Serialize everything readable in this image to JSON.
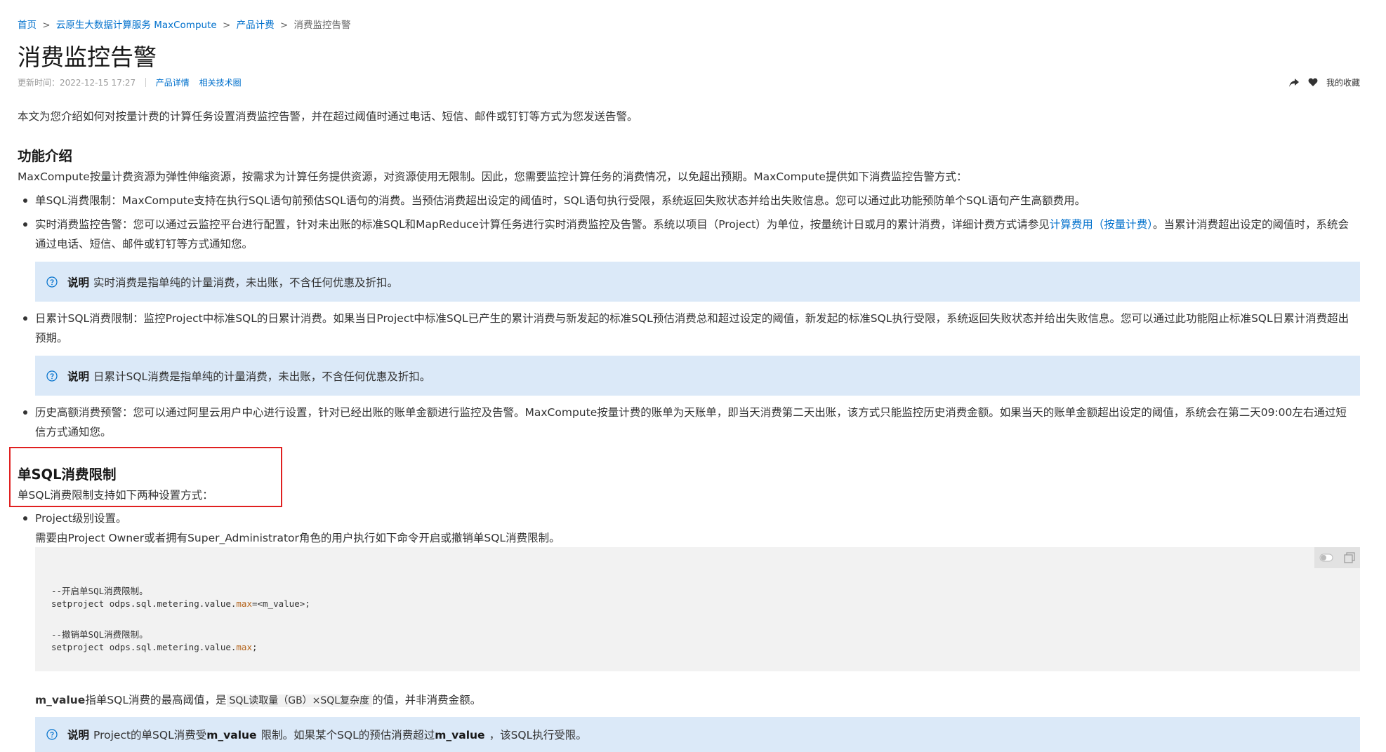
{
  "breadcrumb": {
    "items": [
      "首页",
      "云原生大数据计算服务 MaxCompute",
      "产品计费"
    ],
    "current": "消费监控告警",
    "separator": ">"
  },
  "page": {
    "title": "消费监控告警",
    "updated_label": "更新时间：2022-12-15 17:27",
    "meta_links": [
      "产品详情",
      "相关技术圈"
    ],
    "favorite_label": "我的收藏",
    "intro": "本文为您介绍如何对按量计费的计算任务设置消费监控告警，并在超过阈值时通过电话、短信、邮件或钉钉等方式为您发送告警。"
  },
  "section1": {
    "heading": "功能介绍",
    "lead": "MaxCompute按量计费资源为弹性伸缩资源，按需求为计算任务提供资源，对资源使用无限制。因此，您需要监控计算任务的消费情况，以免超出预期。MaxCompute提供如下消费监控告警方式：",
    "item1": "单SQL消费限制：MaxCompute支持在执行SQL语句前预估SQL语句的消费。当预估消费超出设定的阈值时，SQL语句执行受限，系统返回失败状态并给出失败信息。您可以通过此功能预防单个SQL语句产生高额费用。",
    "item2_a": "实时消费监控告警：您可以通过云监控平台进行配置，针对未出账的标准SQL和MapReduce计算任务进行实时消费监控及告警。系统以项目（Project）为单位，按量统计日或月的累计消费，详细计费方式请参见",
    "item2_link": "计算费用（按量计费）",
    "item2_b": "。当累计消费超出设定的阈值时，系统会通过电话、短信、邮件或钉钉等方式通知您。",
    "note1_label": "说明",
    "note1_text": "实时消费是指单纯的计量消费，未出账，不含任何优惠及折扣。",
    "item3": "日累计SQL消费限制：监控Project中标准SQL的日累计消费。如果当日Project中标准SQL已产生的累计消费与新发起的标准SQL预估消费总和超过设定的阈值，新发起的标准SQL执行受限，系统返回失败状态并给出失败信息。您可以通过此功能阻止标准SQL日累计消费超出预期。",
    "note2_label": "说明",
    "note2_text": "日累计SQL消费是指单纯的计量消费，未出账，不含任何优惠及折扣。",
    "item4": "历史高额消费预警：您可以通过阿里云用户中心进行设置，针对已经出账的账单金额进行监控及告警。MaxCompute按量计费的账单为天账单，即当天消费第二天出账，该方式只能监控历史消费金额。如果当天的账单金额超出设定的阈值，系统会在第二天09:00左右通过短信方式通知您。"
  },
  "section2": {
    "heading": "单SQL消费限制",
    "lead": "单SQL消费限制支持如下两种设置方式：",
    "item1_title": "Project级别设置。",
    "item1_desc": "需要由Project Owner或者拥有Super_Administrator角色的用户执行如下命令开启或撤销单SQL消费限制。",
    "code": {
      "comment1": "--开启单SQL消费限制。",
      "line1_prefix": "setproject odps.sql.metering.value.",
      "line1_kw": "max",
      "line1_suffix": "=<m_value>;",
      "comment2": "--撤销单SQL消费限制。",
      "line2_prefix": "setproject odps.sql.metering.value.",
      "line2_kw": "max",
      "line2_suffix": ";"
    },
    "mvalue_bold": "m_value",
    "mvalue_text_a": "指单SQL消费的最高阈值，是",
    "mvalue_code": "SQL读取量（GB）×SQL复杂度",
    "mvalue_text_b": "的值，并非消费金额。",
    "note3_label": "说明",
    "note3_text_a": "Project的单SQL消费受",
    "note3_bold1": "m_value",
    "note3_text_b": "限制。如果某个SQL的预估消费超过",
    "note3_bold2": "m_value",
    "note3_text_c": "，该SQL执行受限。"
  },
  "colors": {
    "link": "#0070cc",
    "note_bg": "#dbe9f8",
    "highlight_border": "#e02020",
    "code_bg": "#f2f2f2"
  },
  "icons": [
    "share-icon",
    "heart-icon",
    "question-circle-icon",
    "theme-toggle-icon",
    "copy-icon"
  ]
}
